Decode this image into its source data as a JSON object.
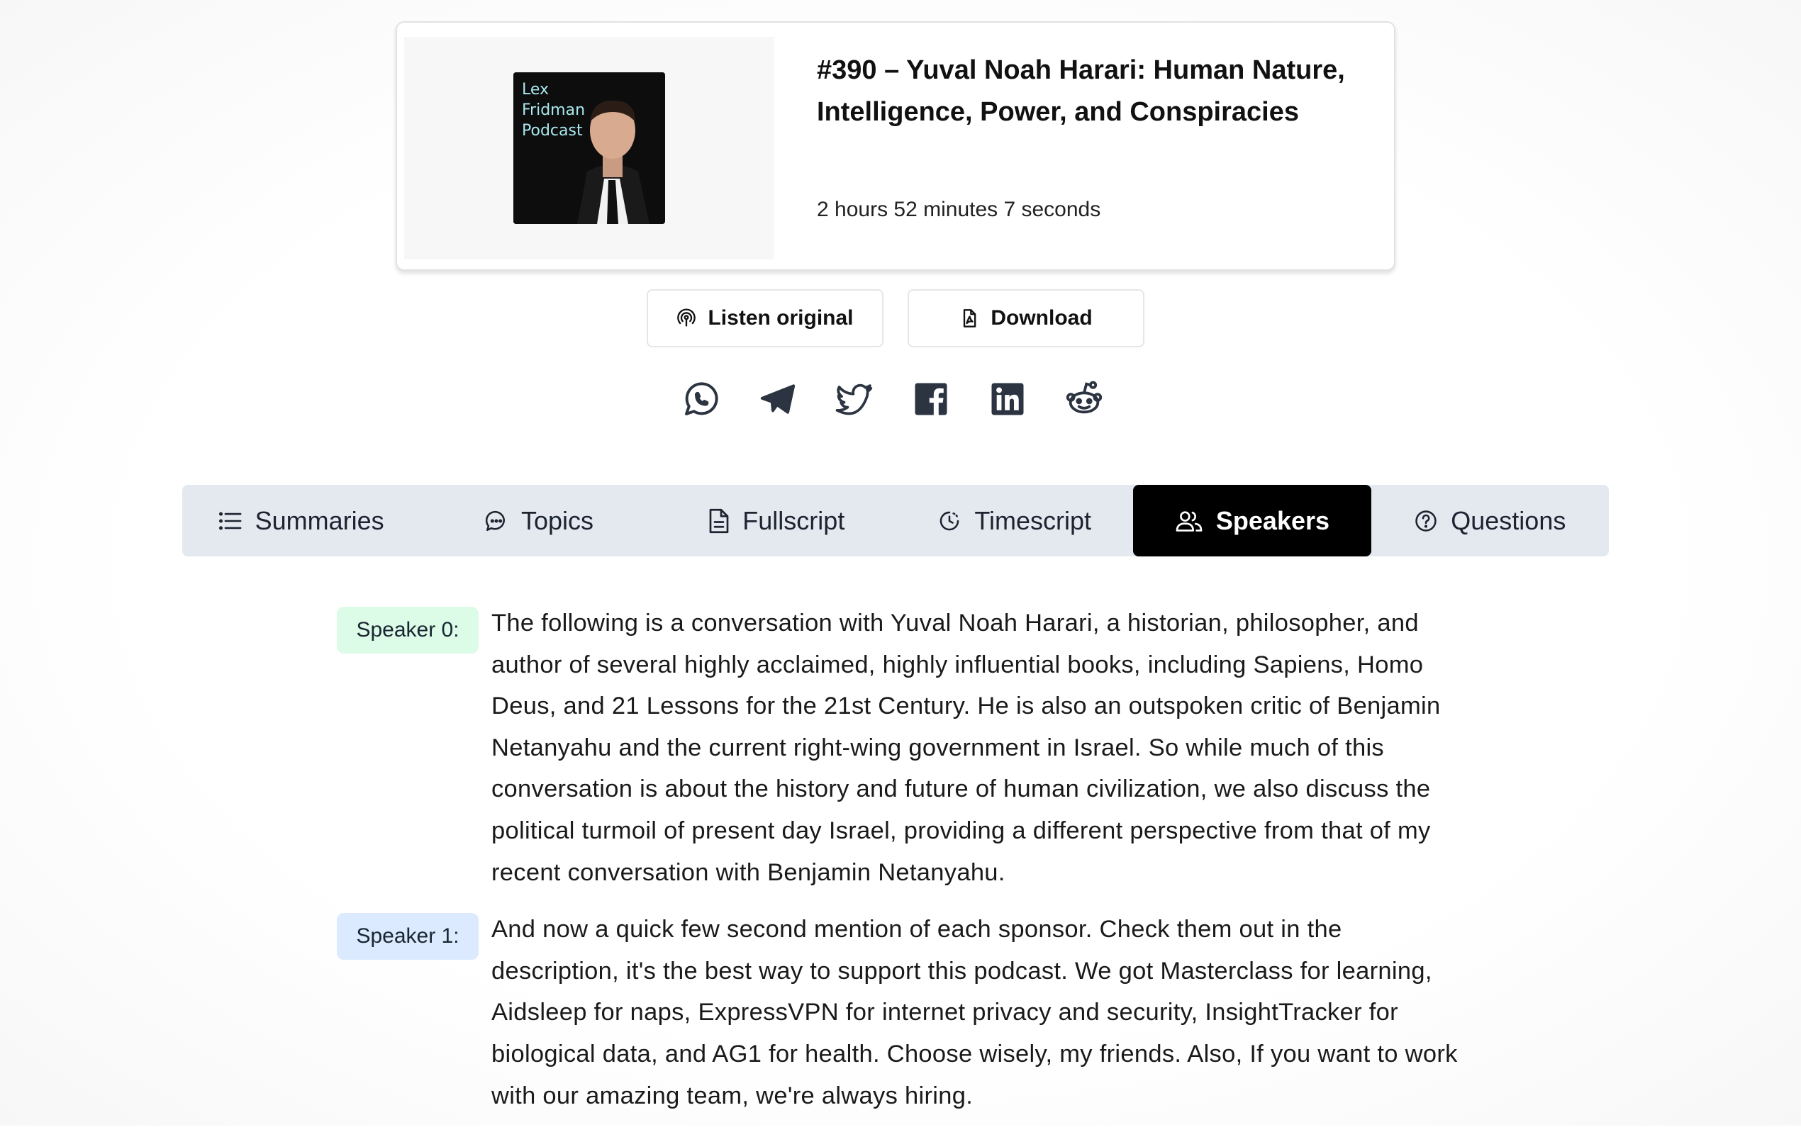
{
  "episode": {
    "cover_text": "Lex\nFridman\nPodcast",
    "title": "#390 – Yuval Noah Harari: Human Nature, Intelligence, Power, and Conspiracies",
    "duration": "2 hours 52 minutes 7 seconds"
  },
  "actions": {
    "listen_label": "Listen original",
    "download_label": "Download"
  },
  "share": [
    "whatsapp-icon",
    "telegram-icon",
    "twitter-icon",
    "facebook-icon",
    "linkedin-icon",
    "reddit-icon"
  ],
  "tabs": [
    {
      "label": "Summaries",
      "icon": "list-icon",
      "active": false
    },
    {
      "label": "Topics",
      "icon": "chat-bubble-icon",
      "active": false
    },
    {
      "label": "Fullscript",
      "icon": "document-icon",
      "active": false
    },
    {
      "label": "Timescript",
      "icon": "clock-icon",
      "active": false
    },
    {
      "label": "Speakers",
      "icon": "users-icon",
      "active": true
    },
    {
      "label": "Questions",
      "icon": "question-circle-icon",
      "active": false
    }
  ],
  "transcript": [
    {
      "speaker": "Speaker 0:",
      "text": "The following is a conversation with Yuval Noah Harari, a historian, philosopher, and author of several highly acclaimed, highly influential books, including Sapiens, Homo Deus, and 21 Lessons for the 21st Century. He is also an outspoken critic of Benjamin Netanyahu and the current right-wing government in Israel. So while much of this conversation is about the history and future of human civilization, we also discuss the political turmoil of present day Israel, providing a different perspective from that of my recent conversation with Benjamin Netanyahu."
    },
    {
      "speaker": "Speaker 1:",
      "text": "And now a quick few second mention of each sponsor. Check them out in the description, it's the best way to support this podcast. We got Masterclass for learning, Aidsleep for naps, ExpressVPN for internet privacy and security, InsightTracker for biological data, and AG1 for health. Choose wisely, my friends. Also, If you want to work with our amazing team, we're always hiring."
    }
  ],
  "colors": {
    "active_tab_bg": "#000000",
    "tab_bar_bg": "#e4e8ef",
    "speaker0_badge": "#dcfce7",
    "speaker1_badge": "#dbeafe"
  }
}
